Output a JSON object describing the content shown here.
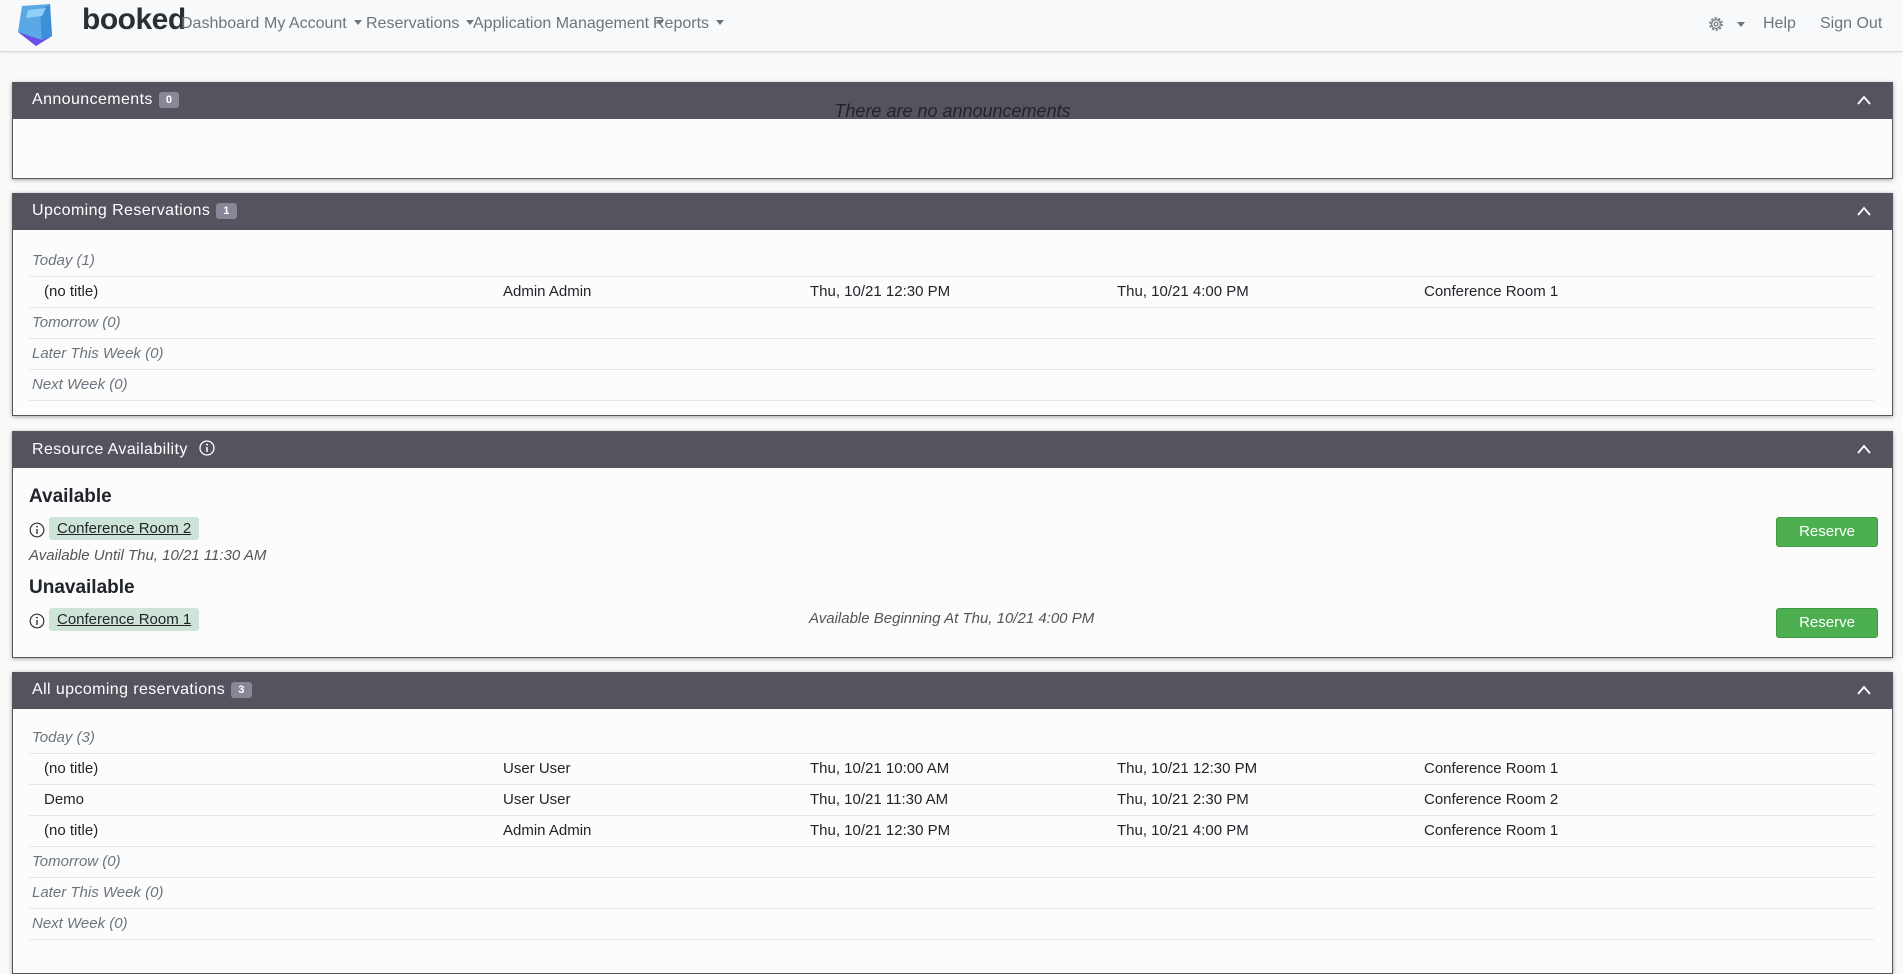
{
  "app": {
    "brand": "booked",
    "nav": [
      {
        "label": "Dashboard",
        "dropdown": false
      },
      {
        "label": "My Account",
        "dropdown": true
      },
      {
        "label": "Reservations",
        "dropdown": true
      },
      {
        "label": "Application Management",
        "dropdown": true
      },
      {
        "label": "Reports",
        "dropdown": true
      }
    ],
    "right_nav": {
      "help": "Help",
      "sign_out": "Sign Out"
    }
  },
  "announcements": {
    "title": "Announcements",
    "count": "0",
    "empty_message": "There are no announcements"
  },
  "upcoming": {
    "title": "Upcoming Reservations",
    "count": "1",
    "groups": [
      {
        "label": "Today (1)",
        "rows": [
          {
            "title": "(no title)",
            "user": "Admin Admin",
            "start": "Thu, 10/21 12:30 PM",
            "end": "Thu, 10/21 4:00 PM",
            "resource": "Conference Room 1"
          }
        ]
      },
      {
        "label": "Tomorrow (0)",
        "rows": []
      },
      {
        "label": "Later This Week (0)",
        "rows": []
      },
      {
        "label": "Next Week (0)",
        "rows": []
      }
    ]
  },
  "availability": {
    "title": "Resource Availability",
    "available_heading": "Available",
    "unavailable_heading": "Unavailable",
    "available": [
      {
        "resource": "Conference Room 2",
        "note": "Available Until Thu, 10/21 11:30 AM",
        "button": "Reserve"
      }
    ],
    "unavailable": [
      {
        "resource": "Conference Room 1",
        "note": "Available Beginning At Thu, 10/21 4:00 PM",
        "button": "Reserve"
      }
    ]
  },
  "all_upcoming": {
    "title": "All upcoming reservations",
    "count": "3",
    "groups": [
      {
        "label": "Today (3)",
        "rows": [
          {
            "title": "(no title)",
            "user": "User User",
            "start": "Thu, 10/21 10:00 AM",
            "end": "Thu, 10/21 12:30 PM",
            "resource": "Conference Room 1"
          },
          {
            "title": "Demo",
            "user": "User User",
            "start": "Thu, 10/21 11:30 AM",
            "end": "Thu, 10/21 2:30 PM",
            "resource": "Conference Room 2"
          },
          {
            "title": "(no title)",
            "user": "Admin Admin",
            "start": "Thu, 10/21 12:30 PM",
            "end": "Thu, 10/21 4:00 PM",
            "resource": "Conference Room 1"
          }
        ]
      },
      {
        "label": "Tomorrow (0)",
        "rows": []
      },
      {
        "label": "Later This Week (0)",
        "rows": []
      },
      {
        "label": "Next Week (0)",
        "rows": []
      }
    ]
  },
  "colors": {
    "panel_header": "#55535e",
    "badge": "#898795",
    "reserve_button": "#4caf50",
    "resource_highlight": "#cfe4d9"
  }
}
